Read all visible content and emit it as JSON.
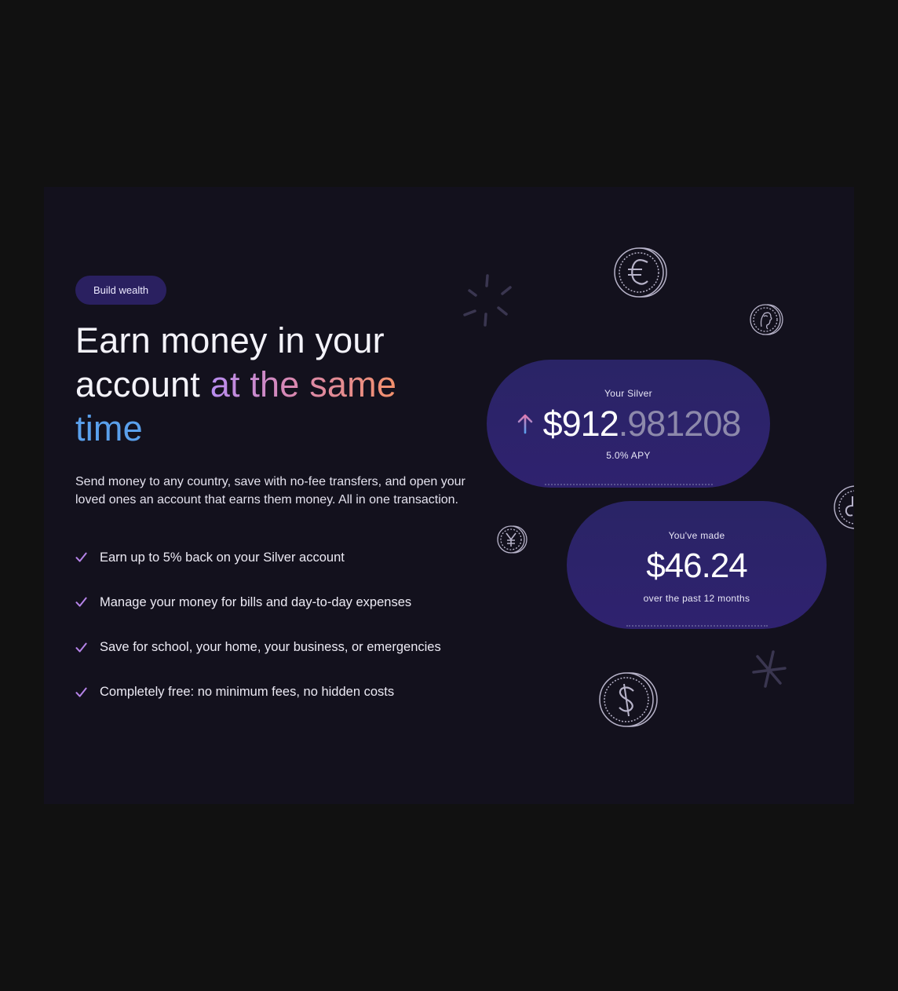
{
  "badge": {
    "label": "Build wealth"
  },
  "headline": {
    "part1": "Earn money in your account ",
    "part2": "at the same",
    "part3": "time"
  },
  "description": "Send money to any country, save with no-fee transfers, and open your loved ones an account that earns them money. All in one transaction.",
  "features": [
    "Earn up to 5% back on your Silver account",
    "Manage your money for bills and day-to-day expenses",
    "Save for school, your home, your business, or emergencies",
    "Completely free: no minimum fees, no hidden costs"
  ],
  "balance_card": {
    "label": "Your Silver",
    "amount_main": "$912",
    "amount_fraction": ".981208",
    "apy": "5.0% APY",
    "trend_icon": "arrow-up-icon"
  },
  "earnings_card": {
    "label": "You've made",
    "amount": "$46.24",
    "period": "over the past 12 months"
  },
  "decorations": [
    "euro-coin-icon",
    "portrait-coin-icon",
    "yen-coin-icon",
    "dollar-coin-icon",
    "rupee-coin-icon",
    "sparkle-burst-icon",
    "asterisk-icon"
  ],
  "colors": {
    "page_background": "#111111",
    "card_background": "#13111d",
    "badge_background": "#2a2060",
    "accent_purple": "#b88cf0",
    "accent_orange": "#f2906b",
    "accent_blue": "#5aa0ec",
    "check": "#b583e8",
    "bubble": "#2a2466"
  }
}
